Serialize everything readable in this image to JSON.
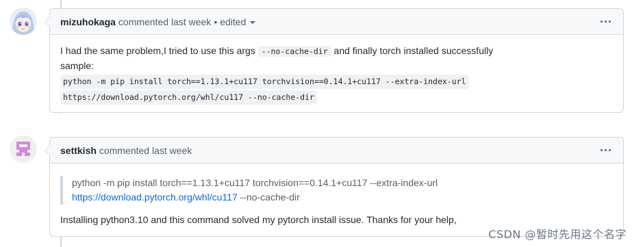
{
  "comments": [
    {
      "author": "mizuhokaga",
      "meta": "commented last week",
      "separator": "•",
      "edited": "edited",
      "body": {
        "line1_before": "I had the same problem,I tried to use this args ",
        "line1_code": "--no-cache-dir",
        "line1_after": " and finally torch installed successfully",
        "line2": "sample:",
        "code_line1": "python -m pip install torch==1.13.1+cu117 torchvision==0.14.1+cu117 --extra-index-url",
        "code_line2": "https://download.pytorch.org/whl/cu117 --no-cache-dir"
      }
    },
    {
      "author": "settkish",
      "meta": "commented last week",
      "body": {
        "quote_line1": "python -m pip install torch==1.13.1+cu117 torchvision==0.14.1+cu117 --extra-index-url",
        "quote_link": "https://download.pytorch.org/whl/cu117",
        "quote_after": " --no-cache-dir",
        "paragraph": "Installing python3.10 and this command solved my pytorch install issue. Thanks for your help,"
      }
    }
  ],
  "watermark": "CSDN @暂时先用这个名字",
  "colors": {
    "border": "#d0d7de",
    "header_bg": "#f6f8fa",
    "link": "#0969da",
    "text": "#24292f",
    "muted": "#57606a"
  },
  "icons": [
    "kebab-menu-icon",
    "caret-down-icon"
  ]
}
